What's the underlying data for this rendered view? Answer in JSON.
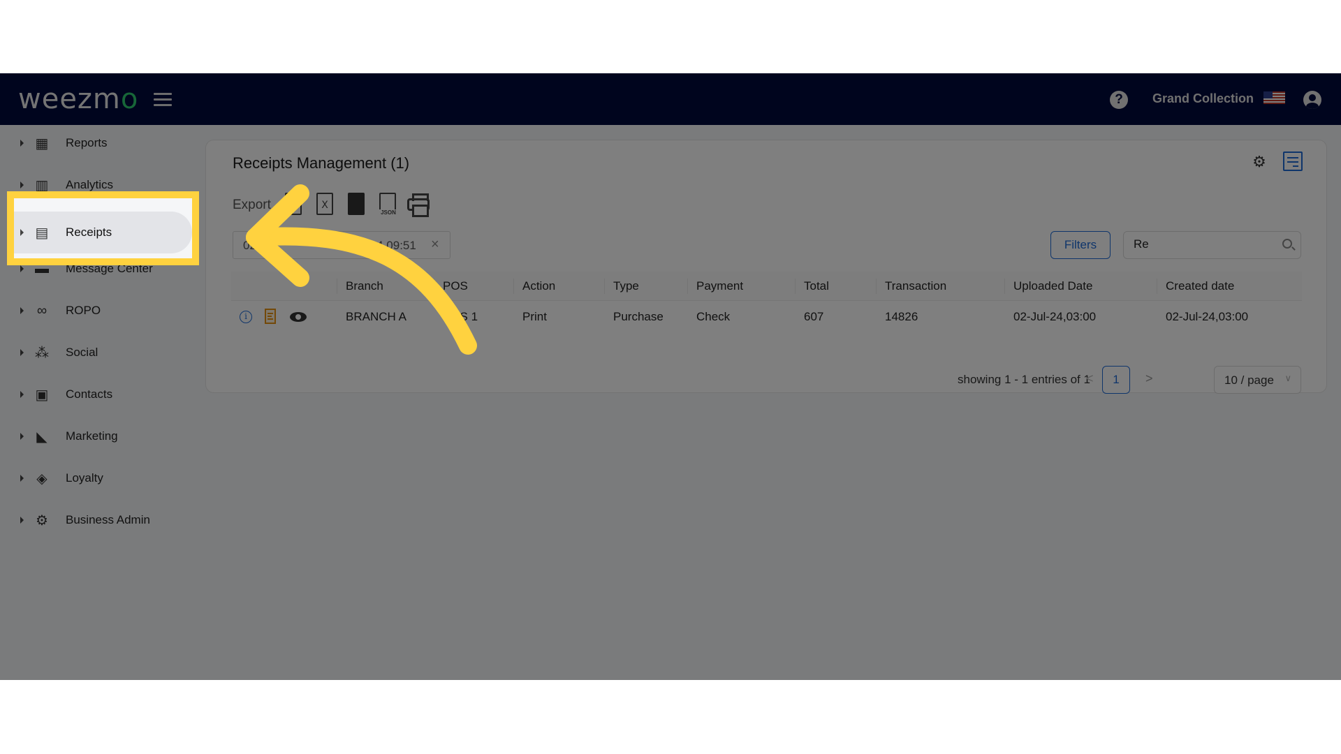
{
  "header": {
    "logo_text_main": "weezm",
    "logo_text_accent": "o",
    "account_name": "Grand Collection",
    "help_glyph": "?",
    "language": "en-US"
  },
  "sidebar": {
    "items": [
      {
        "label": "Reports",
        "icon": "dashboard-icon",
        "glyph": "▦"
      },
      {
        "label": "Analytics",
        "icon": "analytics-icon",
        "glyph": "▥"
      },
      {
        "label": "Receipts",
        "icon": "receipt-icon",
        "glyph": "▤",
        "active": true
      },
      {
        "label": "Message Center",
        "icon": "message-icon",
        "glyph": "▬"
      },
      {
        "label": "ROPO",
        "icon": "infinity-icon",
        "glyph": "∞"
      },
      {
        "label": "Social",
        "icon": "people-icon",
        "glyph": "⁂"
      },
      {
        "label": "Contacts",
        "icon": "contacts-icon",
        "glyph": "▣"
      },
      {
        "label": "Marketing",
        "icon": "party-popper-icon",
        "glyph": "◣"
      },
      {
        "label": "Loyalty",
        "icon": "tag-icon",
        "glyph": "◈"
      },
      {
        "label": "Business Admin",
        "icon": "gear-icon",
        "glyph": "⚙"
      }
    ]
  },
  "main": {
    "title": "Receipts Management (1)",
    "settings_glyph": "⚙",
    "export": {
      "label": "Export",
      "buttons": [
        {
          "name": "export-csv",
          "text": ""
        },
        {
          "name": "export-excel",
          "text": "X"
        },
        {
          "name": "export-pdf",
          "text": ""
        },
        {
          "name": "export-json",
          "text": "JSON"
        },
        {
          "name": "print",
          "text": ""
        }
      ]
    },
    "date_filter": {
      "start_visible": "02",
      "end_visible": "-24 09:51",
      "clear_glyph": "×"
    },
    "filters_label": "Filters",
    "search": {
      "value": "Re",
      "placeholder": ""
    },
    "table": {
      "columns": [
        "",
        "Branch",
        "POS",
        "Action",
        "Type",
        "Payment",
        "Total",
        "Transaction",
        "Uploaded Date",
        "Created date"
      ],
      "rows": [
        {
          "branch": "BRANCH A",
          "pos": "POS 1",
          "action": "Print",
          "type": "Purchase",
          "payment": "Check",
          "total": "607",
          "transaction": "14826",
          "uploaded_date": "02-Jul-24,03:00",
          "created_date": "02-Jul-24,03:00"
        }
      ]
    },
    "pagination": {
      "summary": "showing 1 - 1 entries of 1",
      "prev_glyph": "<",
      "current_page": "1",
      "next_glyph": ">",
      "page_size": "10 / page",
      "chevron_glyph": "∨"
    }
  },
  "annotation": {
    "highlight_color": "#ffd23f",
    "highlight_target": "Receipts"
  },
  "colors": {
    "header_bg": "#000a3c",
    "accent": "#1e6bd6",
    "logo_accent": "#2ecc71",
    "receipt_icon": "#e69213"
  }
}
